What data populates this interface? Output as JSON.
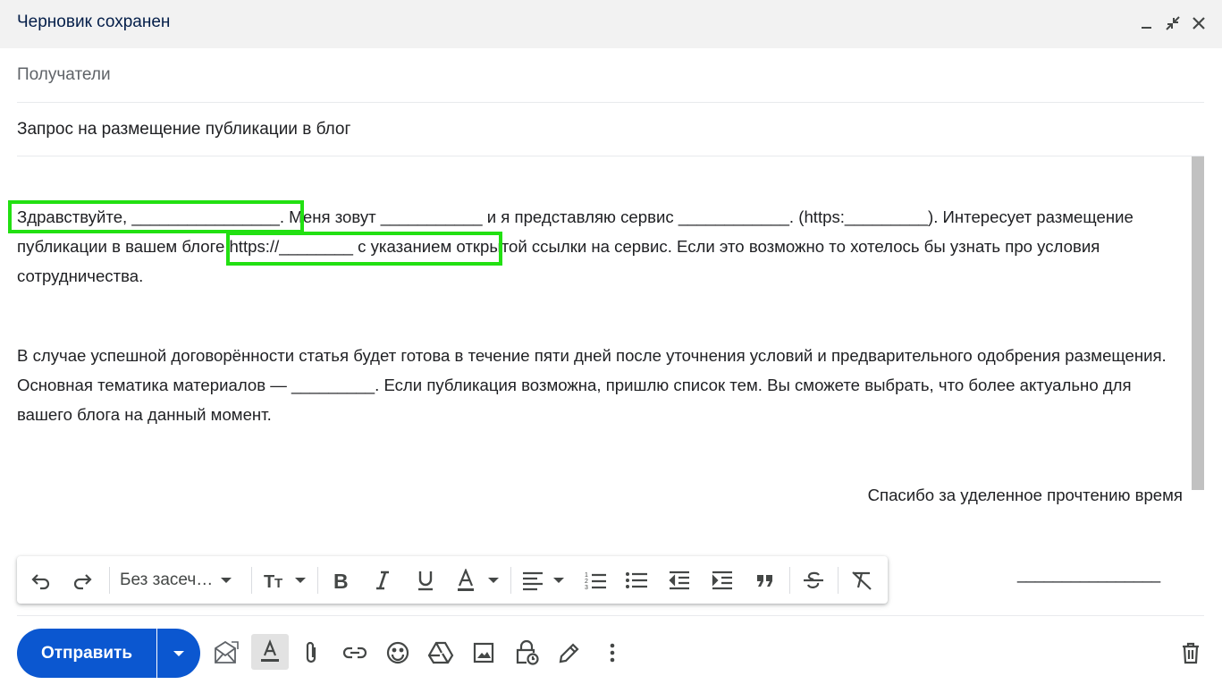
{
  "header": {
    "title": "Черновик сохранен",
    "controls": [
      "minimize-icon",
      "fullscreen-exit-icon",
      "close-icon"
    ]
  },
  "recipients": {
    "placeholder": "Получатели"
  },
  "subject": {
    "value": "Запрос на размещение публикации в блог"
  },
  "body": {
    "paragraph1": "Здравствуйте, ________________. Меня зовут ___________ и я представляю сервис ____________. (https:_________). Интересует размещение публикации в вашем блоге https://________ с указанием открытой ссылки на сервис. Если это возможно то хотелось бы узнать про условия сотрудничества.",
    "paragraph2": "В случае успешной договорённости статья будет готова в течение пяти дней после уточнения условий и предварительного одобрения размещения. Основная тематика материалов — _________. Если публикация возможна, пришлю список тем. Вы сможете выбрать, что более актуально для вашего блога на данный момент.",
    "thanks": "Спасибо за уделенное прочтению время",
    "signature_line": "________________"
  },
  "highlight_color": "#22e012",
  "format_toolbar": {
    "font": "Без засеч…",
    "buttons": [
      "undo-icon",
      "redo-icon",
      "font-select",
      "text-size-icon",
      "bold-icon",
      "italic-icon",
      "underline-icon",
      "text-color-icon",
      "align-icon",
      "numbered-list-icon",
      "bulleted-list-icon",
      "indent-less-icon",
      "indent-more-icon",
      "quote-icon",
      "strikethrough-icon",
      "remove-formatting-icon"
    ]
  },
  "bottom_toolbar": {
    "send_label": "Отправить",
    "accent": "#0b57d0",
    "buttons": [
      "schedule-send-icon",
      "formatting-options-icon",
      "attach-icon",
      "link-icon",
      "emoji-icon",
      "drive-icon",
      "photo-icon",
      "confidential-mode-icon",
      "signature-icon",
      "more-options-icon",
      "discard-icon"
    ]
  }
}
